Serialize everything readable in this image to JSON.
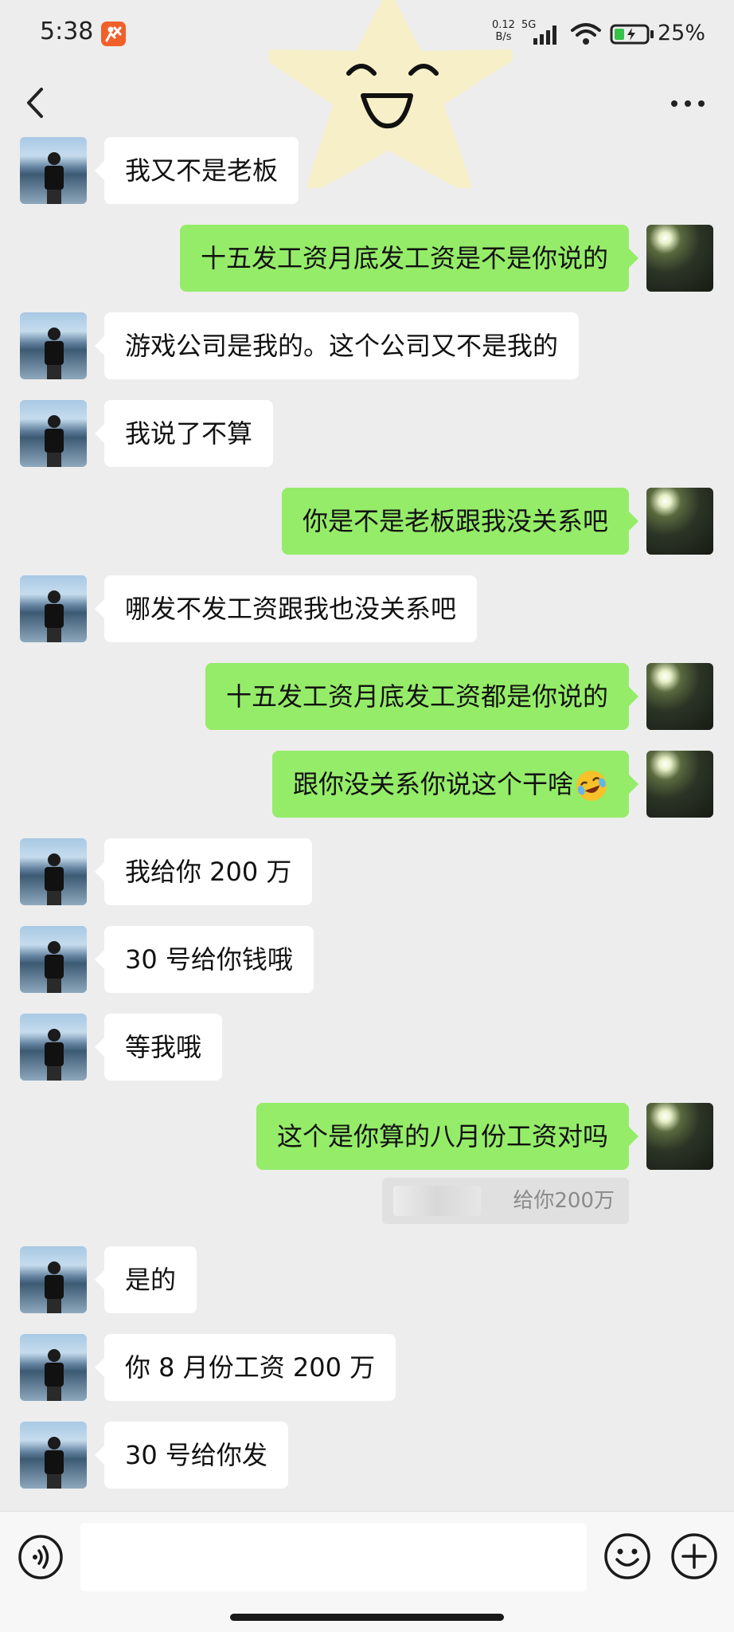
{
  "status_bar": {
    "time": "5:38",
    "net_speed_value": "0.12",
    "net_speed_unit": "B/s",
    "network": "5G",
    "battery": "25%"
  },
  "colors": {
    "background": "#ededed",
    "self_bubble": "#95ec69",
    "other_bubble": "#ffffff"
  },
  "messages": [
    {
      "side": "recv",
      "text": "我又不是老板"
    },
    {
      "side": "self",
      "text": "十五发工资月底发工资是不是你说的"
    },
    {
      "side": "recv",
      "text": "游戏公司是我的。这个公司又不是我的"
    },
    {
      "side": "recv",
      "text": "我说了不算"
    },
    {
      "side": "self",
      "text": "你是不是老板跟我没关系吧"
    },
    {
      "side": "recv",
      "text": "哪发不发工资跟我也没关系吧"
    },
    {
      "side": "self",
      "text": "十五发工资月底发工资都是你说的"
    },
    {
      "side": "self",
      "text": "跟你没关系你说这个干啥",
      "emoji": "laughing-crying-face"
    },
    {
      "side": "recv",
      "text": "我给你 200 万"
    },
    {
      "side": "recv",
      "text": "30 号给你钱哦"
    },
    {
      "side": "recv",
      "text": "等我哦"
    },
    {
      "side": "self",
      "text": "这个是你算的八月份工资对吗"
    },
    {
      "side": "recv",
      "text": "是的"
    },
    {
      "side": "recv",
      "text": "你 8 月份工资 200 万"
    },
    {
      "side": "recv",
      "text": "30 号给你发"
    }
  ],
  "quoted_message": {
    "text": "给你200万"
  },
  "input": {
    "value": "",
    "placeholder": ""
  }
}
